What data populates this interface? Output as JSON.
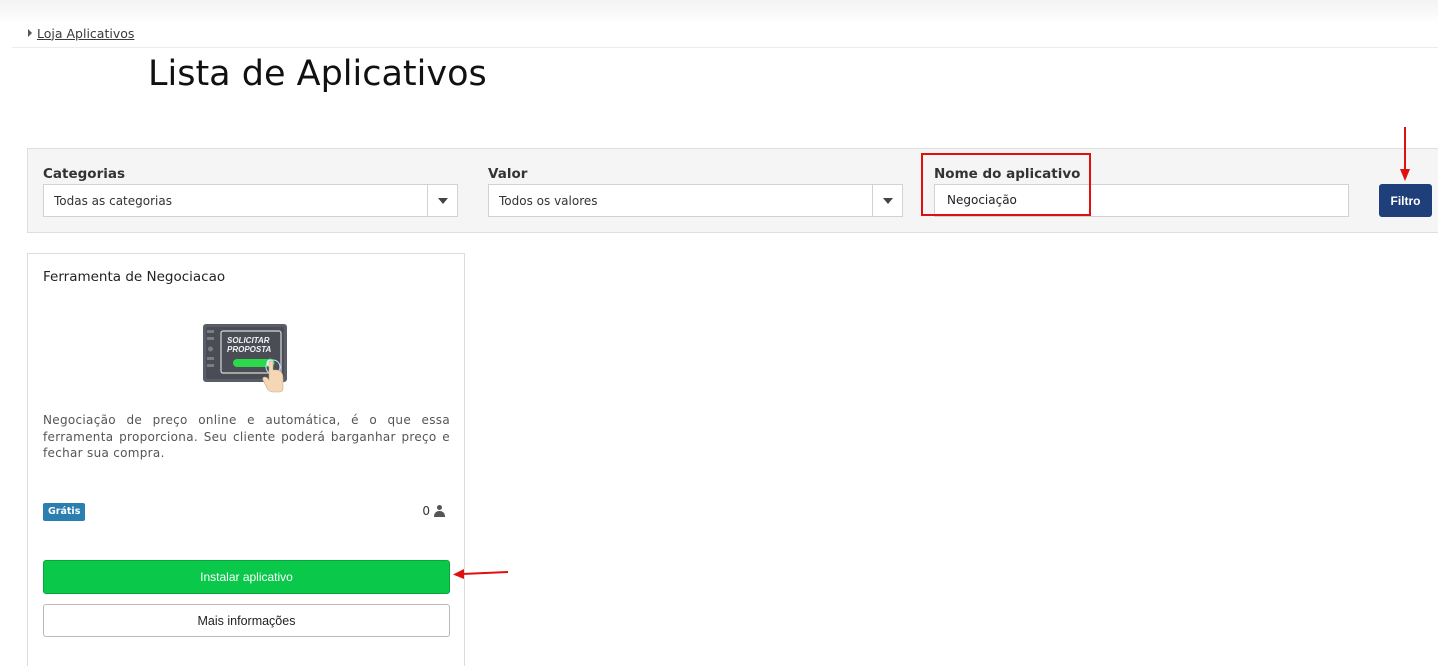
{
  "breadcrumb": {
    "link_label": "Loja Aplicativos"
  },
  "page": {
    "title": "Lista de Aplicativos"
  },
  "filters": {
    "category": {
      "label": "Categorias",
      "selected": "Todas as categorias"
    },
    "value": {
      "label": "Valor",
      "selected": "Todos os valores"
    },
    "app_name": {
      "label": "Nome do aplicativo",
      "value": "Negociação"
    },
    "submit_label": "Filtro"
  },
  "app_card": {
    "title": "Ferramenta de Negociacao",
    "icon_text_line1": "SOLICITAR",
    "icon_text_line2": "PROPOSTA",
    "description": "Negociação de preço online e automática, é o que essa ferramenta proporciona. Seu cliente poderá barganhar preço e fechar sua compra.",
    "price_badge": "Grátis",
    "install_count": "0",
    "install_label": "Instalar aplicativo",
    "more_info_label": "Mais informações"
  },
  "annotation_color": "#e01010",
  "colors": {
    "filter_button": "#1f3f7a",
    "install_button": "#0ac94a",
    "badge": "#2a7fb0"
  }
}
